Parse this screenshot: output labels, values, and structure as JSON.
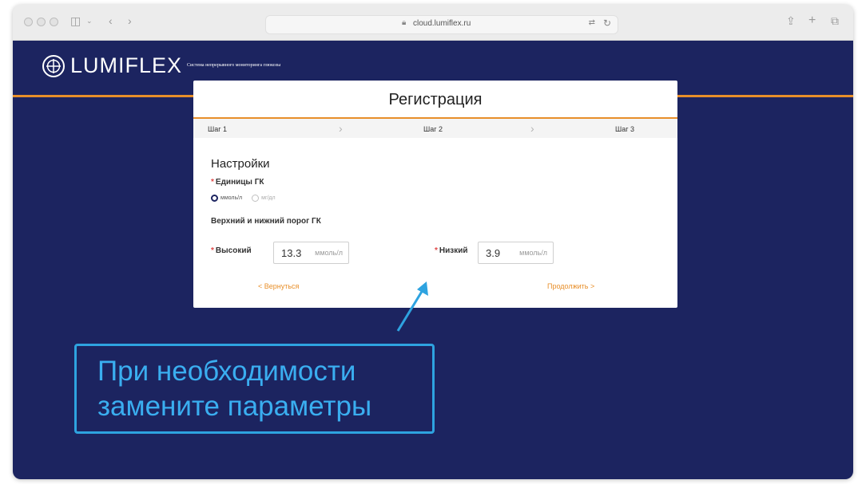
{
  "browser": {
    "url": "cloud.lumiflex.ru",
    "icons": [
      "sidebar-icon",
      "back-icon",
      "forward-icon",
      "lock-icon",
      "translate-icon",
      "reload-icon",
      "share-icon",
      "new-tab-icon",
      "tabs-icon"
    ]
  },
  "header": {
    "logo_text": "LUMIFLEX",
    "tagline": "Система непрерывного мониторинга глюкозы"
  },
  "card": {
    "title": "Регистрация",
    "steps": [
      "Шаг 1",
      "Шаг 2",
      "Шаг 3"
    ],
    "section_title": "Настройки",
    "units_label": "Единицы ГК",
    "units_options": [
      "ммоль/л",
      "мг/дл"
    ],
    "units_selected": "ммоль/л",
    "threshold_label": "Верхний и нижний порог ГК",
    "high_label": "Высокий",
    "high_value": "13.3",
    "low_label": "Низкий",
    "low_value": "3.9",
    "unit": "ммоль/л",
    "back_label": "< Вернуться",
    "next_label": "Продолжить >"
  },
  "callout": {
    "line1": "При необходимости",
    "line2": "замените параметры",
    "color": "#2ea3e0"
  },
  "colors": {
    "page_bg": "#1c2460",
    "accent": "#e88f2a"
  }
}
